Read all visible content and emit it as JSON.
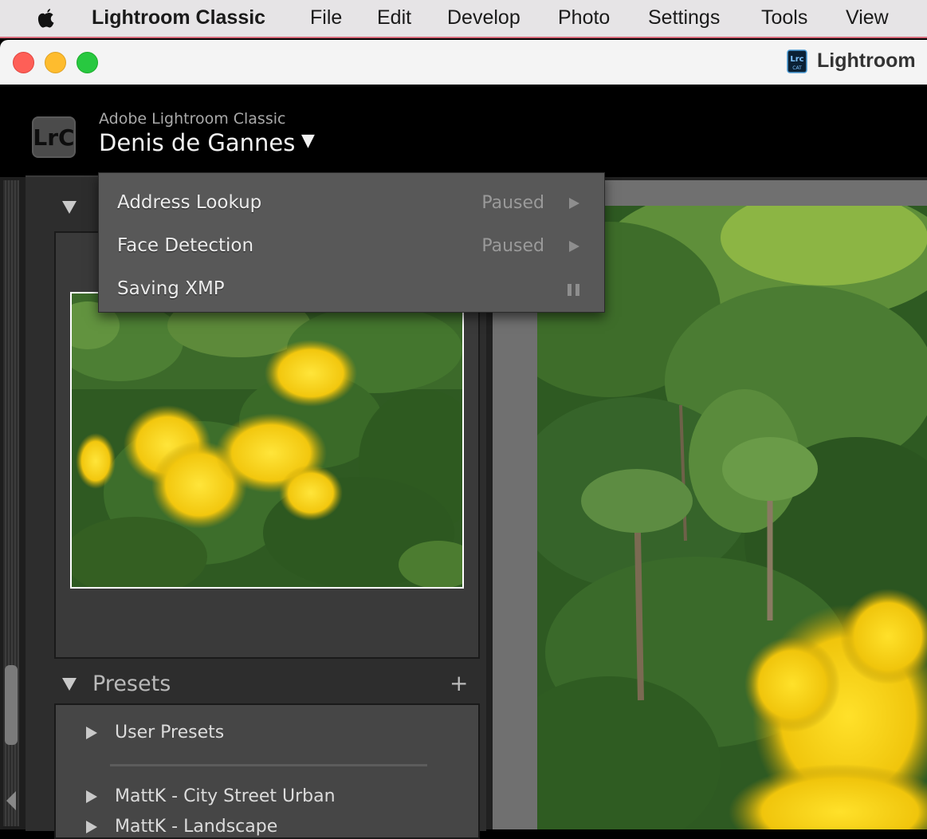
{
  "menubar": {
    "app_name": "Lightroom Classic",
    "items": [
      "File",
      "Edit",
      "Develop",
      "Photo",
      "Settings",
      "Tools",
      "View"
    ]
  },
  "window": {
    "title": "Lightroom"
  },
  "identity_plate": {
    "logo": "LrC",
    "product": "Adobe Lightroom Classic",
    "user_name": "Denis de Gannes",
    "caret": "▼"
  },
  "activity_menu": {
    "items": [
      {
        "label": "Address Lookup",
        "status": "Paused",
        "control": "play-icon"
      },
      {
        "label": "Face Detection",
        "status": "Paused",
        "control": "play-icon"
      },
      {
        "label": "Saving XMP",
        "status": "",
        "control": "pause-icon"
      }
    ]
  },
  "presets": {
    "title": "Presets",
    "add_symbol": "+",
    "items": [
      "User Presets",
      "MattK - City Street Urban",
      "MattK - Landscape"
    ]
  },
  "colors": {
    "menubar_bg": "#e6e4e6",
    "panel_bg": "#2d2d2d",
    "menu_bg": "#585858",
    "blossom_yellow": "#f5d20f"
  }
}
